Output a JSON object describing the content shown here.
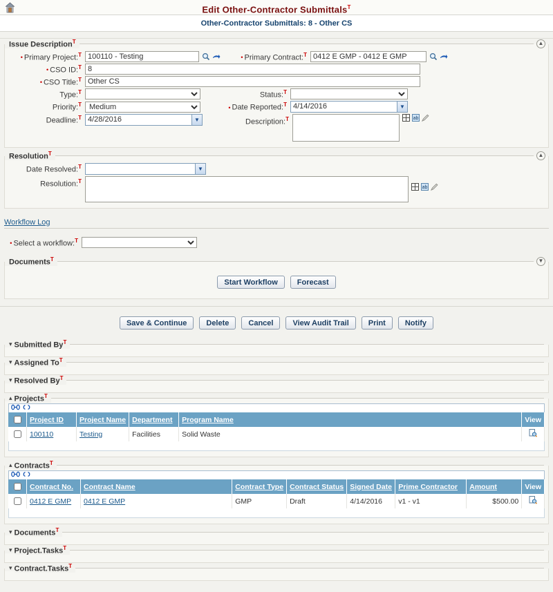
{
  "header": {
    "home_icon": "home-icon",
    "title": "Edit Other-Contractor Submittals",
    "title_sup": "T",
    "subtitle": "Other-Contractor Submittals: 8 - Other CS"
  },
  "issue_description": {
    "legend": "Issue Description",
    "legend_sup": "T",
    "collapse_icon": "chevron-up-icon",
    "fields": {
      "primary_project": {
        "label": "Primary Project:",
        "required": true,
        "value": "100110 - Testing",
        "search_icon": "magnifier-icon",
        "goto_icon": "arrow-right-icon"
      },
      "primary_contract": {
        "label": "Primary Contract:",
        "required": true,
        "value": "0412 E GMP - 0412 E GMP",
        "search_icon": "magnifier-icon",
        "goto_icon": "arrow-right-icon"
      },
      "cso_id": {
        "label": "CSO ID:",
        "required": true,
        "value": "8"
      },
      "cso_title": {
        "label": "CSO Title:",
        "required": true,
        "value": "Other CS"
      },
      "type": {
        "label": "Type:",
        "required": false,
        "value": "",
        "options": [
          ""
        ]
      },
      "status": {
        "label": "Status:",
        "required": false,
        "value": "",
        "options": [
          ""
        ]
      },
      "priority": {
        "label": "Priority:",
        "required": false,
        "value": "Medium",
        "options": [
          "Medium"
        ]
      },
      "date_reported": {
        "label": "Date Reported:",
        "required": true,
        "value": "4/14/2016",
        "picker_icon": "calendar-dropdown-icon"
      },
      "deadline": {
        "label": "Deadline:",
        "required": false,
        "value": "4/28/2016",
        "picker_icon": "calendar-dropdown-icon"
      },
      "description": {
        "label": "Description:",
        "required": false,
        "value": "",
        "tools": [
          "expand-icon",
          "spellcheck-icon",
          "edit-pencil-icon"
        ]
      }
    }
  },
  "resolution": {
    "legend": "Resolution",
    "legend_sup": "T",
    "collapse_icon": "chevron-up-icon",
    "fields": {
      "date_resolved": {
        "label": "Date Resolved:",
        "required": false,
        "value": "",
        "picker_icon": "calendar-dropdown-icon"
      },
      "resolution": {
        "label": "Resolution:",
        "required": false,
        "value": "",
        "tools": [
          "expand-icon",
          "spellcheck-icon",
          "edit-pencil-icon"
        ]
      }
    }
  },
  "workflow_log": {
    "link": "Workflow Log",
    "select_label": "Select a workflow:",
    "select_required": true,
    "select_value": "",
    "options": [
      ""
    ]
  },
  "documents_section": {
    "legend": "Documents",
    "legend_sup": "T",
    "collapse_icon": "chevron-down-icon",
    "buttons": [
      {
        "label": "Start Workflow",
        "name": "start-workflow-button"
      },
      {
        "label": "Forecast",
        "name": "forecast-button"
      }
    ]
  },
  "action_buttons": [
    {
      "label": "Save & Continue",
      "name": "save-and-continue-button"
    },
    {
      "label": "Delete",
      "name": "delete-button"
    },
    {
      "label": "Cancel",
      "name": "cancel-button"
    },
    {
      "label": "View Audit Trail",
      "name": "view-audit-trail-button"
    },
    {
      "label": "Print",
      "name": "print-button"
    },
    {
      "label": "Notify",
      "name": "notify-button"
    }
  ],
  "collapsed_panels_top": [
    {
      "label": "Submitted By",
      "sup": "T",
      "icon": "chevron-down-icon"
    },
    {
      "label": "Assigned To",
      "sup": "T",
      "icon": "chevron-down-icon"
    },
    {
      "label": "Resolved By",
      "sup": "T",
      "icon": "chevron-down-icon"
    }
  ],
  "projects_panel": {
    "legend": "Projects",
    "legend_sup": "T",
    "icon": "chevron-up-icon",
    "toolbar_icons": [
      "link-icon",
      "unlink-icon"
    ],
    "columns": [
      "Project ID",
      "Project Name",
      "Department",
      "Program Name",
      "View"
    ],
    "rows": [
      {
        "selected": false,
        "project_id": "100110",
        "project_name": "Testing",
        "department": "Facilities",
        "program_name": "Solid Waste",
        "view_icon": "view-detail-icon"
      }
    ]
  },
  "contracts_panel": {
    "legend": "Contracts",
    "legend_sup": "T",
    "icon": "chevron-up-icon",
    "toolbar_icons": [
      "link-icon",
      "unlink-icon"
    ],
    "columns": [
      "Contract No.",
      "Contract Name",
      "Contract Type",
      "Contract Status",
      "Signed Date",
      "Prime Contractor",
      "Amount",
      "View"
    ],
    "rows": [
      {
        "selected": false,
        "contract_no": "0412 E GMP",
        "contract_name": "0412 E GMP",
        "contract_type": "GMP",
        "contract_status": "Draft",
        "signed_date": "4/14/2016",
        "prime_contractor": "v1 - v1",
        "amount": "$500.00",
        "view_icon": "view-detail-icon"
      }
    ]
  },
  "collapsed_panels_bottom": [
    {
      "label": "Documents",
      "sup": "T",
      "icon": "chevron-down-icon"
    },
    {
      "label": "Project.Tasks",
      "sup": "T",
      "icon": "chevron-down-icon"
    },
    {
      "label": "Contract.Tasks",
      "sup": "T",
      "icon": "chevron-down-icon"
    }
  ],
  "colors": {
    "title": "#7a1010",
    "subtitle": "#16436e",
    "table_header": "#6ba2c4",
    "link": "#1c5a8c",
    "required_mark": "#c00000",
    "page_bg": "#f2f2ee"
  }
}
